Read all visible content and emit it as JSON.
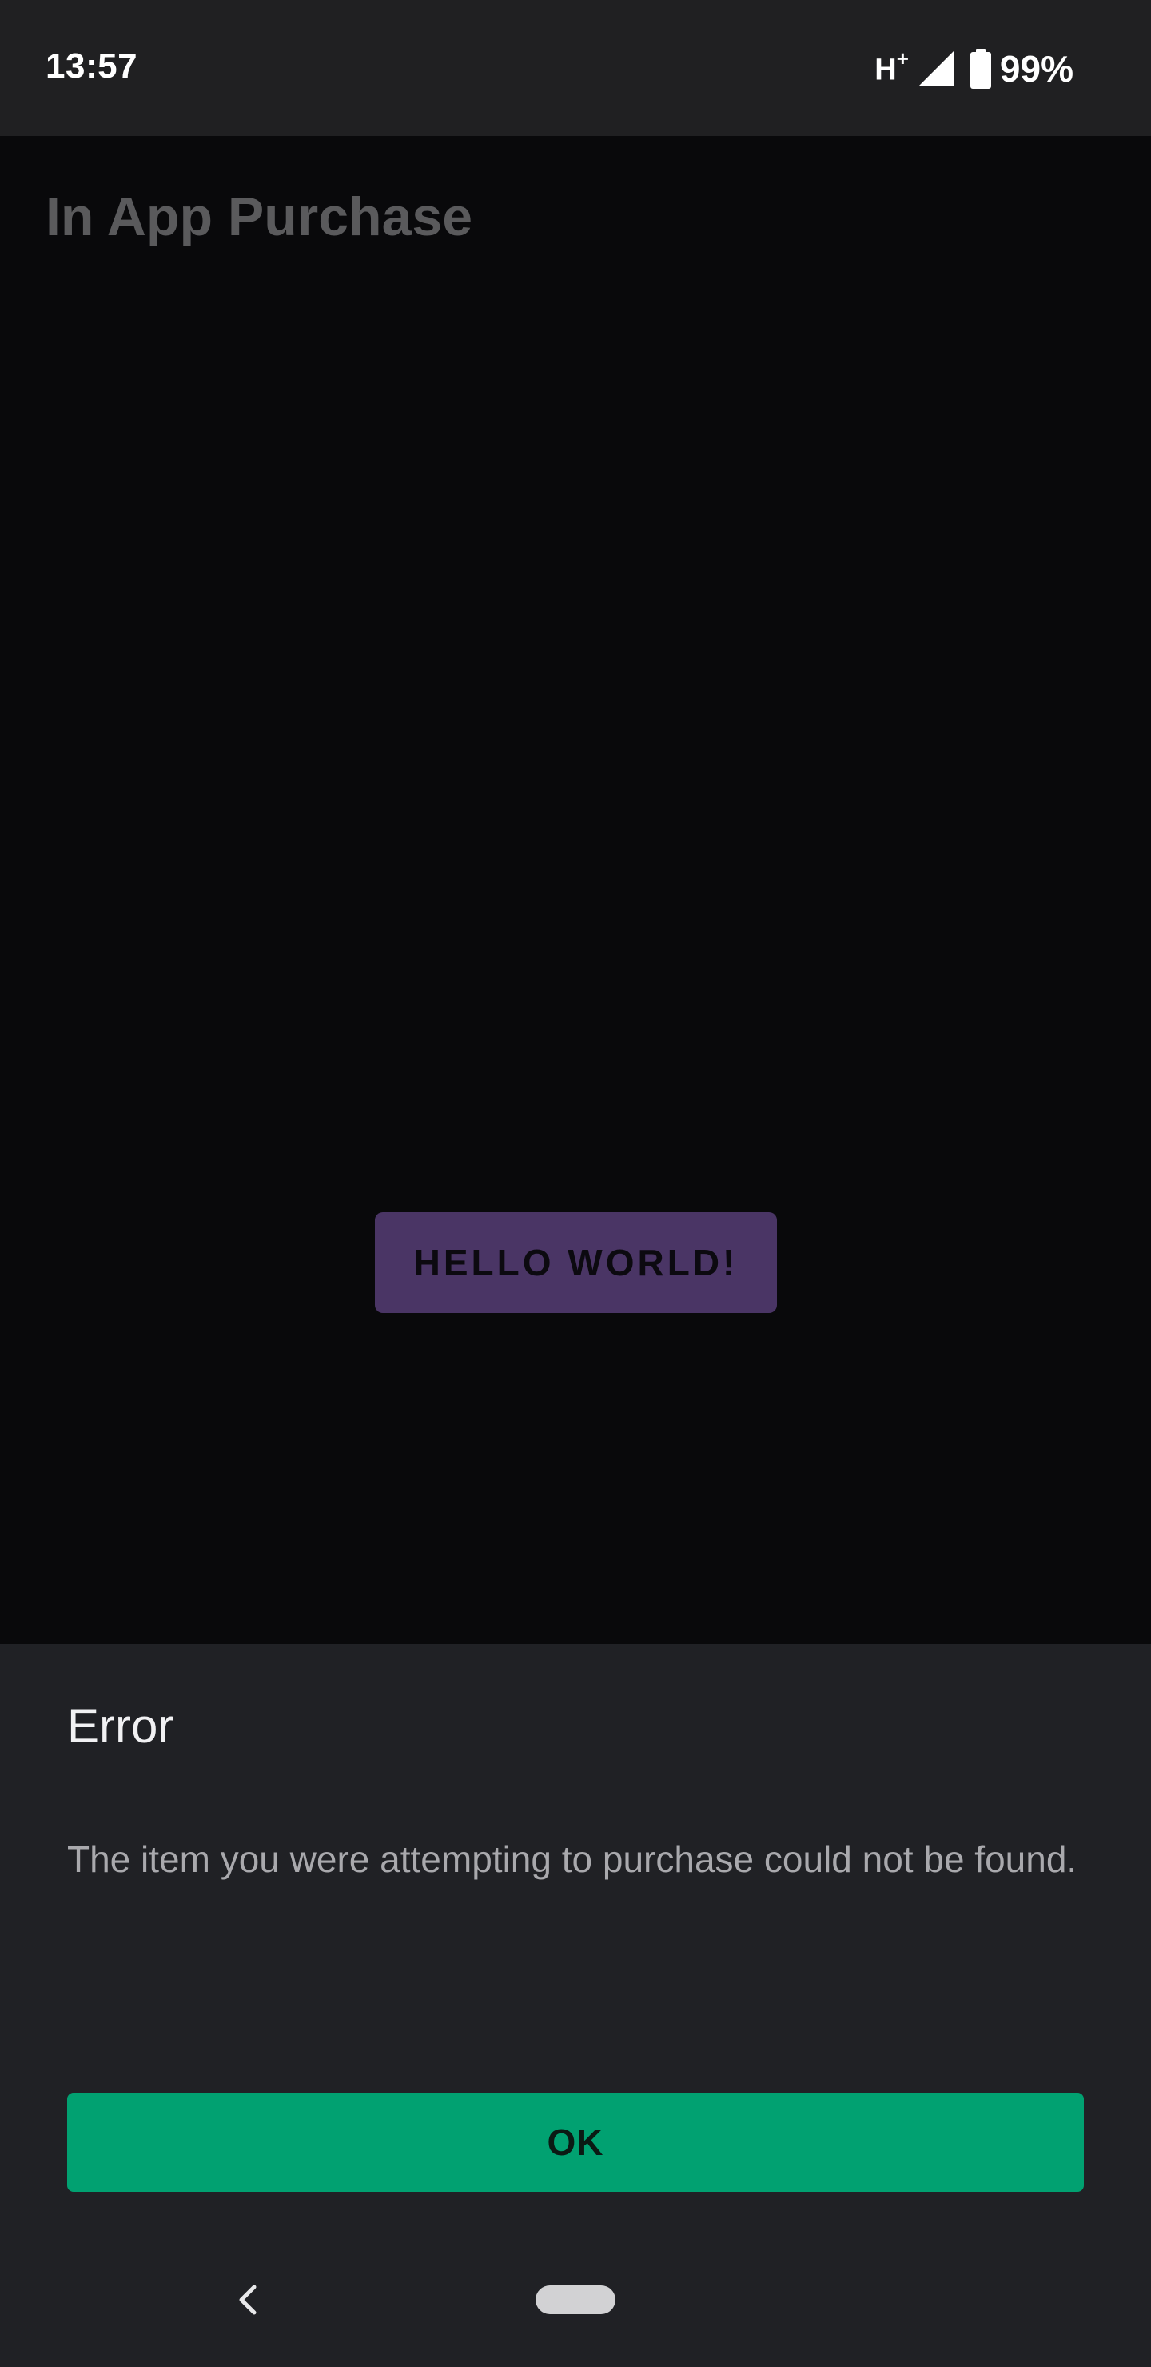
{
  "status_bar": {
    "time": "13:57",
    "network_type": "H",
    "network_suffix": "+",
    "battery": "99%",
    "icons": [
      "signal-icon",
      "battery-icon"
    ]
  },
  "app": {
    "title": "In App Purchase",
    "hello_button_label": "HELLO WORLD!",
    "accent_color": "#4a3565"
  },
  "dialog": {
    "title": "Error",
    "message": "The item you were attempting to purchase could not be found.",
    "ok_label": "OK",
    "ok_color": "#01a171"
  },
  "nav_bar": {
    "icons": [
      "back-icon",
      "home-pill-icon"
    ]
  }
}
